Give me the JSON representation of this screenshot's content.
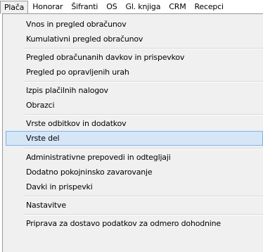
{
  "menubar": {
    "items": [
      {
        "label": "Plača"
      },
      {
        "label": "Honorar"
      },
      {
        "label": "Šifranti"
      },
      {
        "label": "OS"
      },
      {
        "label": "Gl. knjiga"
      },
      {
        "label": "CRM"
      },
      {
        "label": "Recepci"
      }
    ]
  },
  "dropdown": {
    "items": [
      {
        "label": "Vnos in pregled obračunov"
      },
      {
        "label": "Kumulativni pregled obračunov"
      },
      {
        "label": "Pregled obračunanih davkov in prispevkov"
      },
      {
        "label": "Pregled po opravljenih urah"
      },
      {
        "label": "Izpis plačilnih nalogov"
      },
      {
        "label": "Obrazci"
      },
      {
        "label": "Vrste odbitkov in dodatkov"
      },
      {
        "label": "Vrste del"
      },
      {
        "label": "Administrativne prepovedi in odtegljaji"
      },
      {
        "label": "Dodatno pokojninsko zavarovanje"
      },
      {
        "label": "Davki in prispevki"
      },
      {
        "label": "Nastavitve"
      },
      {
        "label": "Priprava za dostavo podatkov za odmero dohodnine"
      }
    ],
    "selected_label": "Vrste del"
  }
}
